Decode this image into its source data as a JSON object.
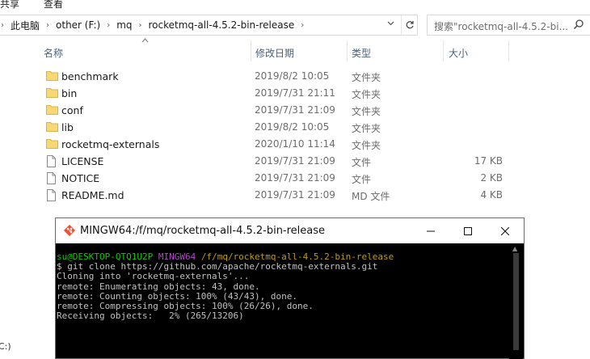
{
  "ribbon": {
    "tabs": [
      "共享",
      "查看"
    ]
  },
  "address_bar": {
    "crumbs": [
      "此电脑",
      "other (F:)",
      "mq",
      "rocketmq-all-4.5.2-bin-release"
    ]
  },
  "search": {
    "placeholder": "搜索\"rocketmq-all-4.5.2-bi..."
  },
  "columns": {
    "name": "名称",
    "date": "修改日期",
    "type": "类型",
    "size": "大小"
  },
  "files": [
    {
      "name": "benchmark",
      "date": "2019/8/2 10:05",
      "type": "文件夹",
      "size": "",
      "kind": "folder"
    },
    {
      "name": "bin",
      "date": "2019/7/31 21:11",
      "type": "文件夹",
      "size": "",
      "kind": "folder"
    },
    {
      "name": "conf",
      "date": "2019/7/31 21:09",
      "type": "文件夹",
      "size": "",
      "kind": "folder"
    },
    {
      "name": "lib",
      "date": "2019/8/2 10:05",
      "type": "文件夹",
      "size": "",
      "kind": "folder"
    },
    {
      "name": "rocketmq-externals",
      "date": "2020/1/10 11:14",
      "type": "文件夹",
      "size": "",
      "kind": "folder"
    },
    {
      "name": "LICENSE",
      "date": "2019/7/31 21:09",
      "type": "文件",
      "size": "17 KB",
      "kind": "file"
    },
    {
      "name": "NOTICE",
      "date": "2019/7/31 21:09",
      "type": "文件",
      "size": "2 KB",
      "kind": "file"
    },
    {
      "name": "README.md",
      "date": "2019/7/31 21:09",
      "type": "MD 文件",
      "size": "4 KB",
      "kind": "file"
    }
  ],
  "left_edge": {
    "text": "C:)"
  },
  "terminal": {
    "title": "MINGW64:/f/mq/rocketmq-all-4.5.2-bin-release",
    "prompt_user": "su@DESKTOP-QTQ1U2P",
    "prompt_env": "MINGW64",
    "prompt_path": "/f/mq/rocketmq-all-4.5.2-bin-release",
    "lines": [
      "$ git clone https://github.com/apache/rocketmq-externals.git",
      "Cloning into 'rocketmq-externals'...",
      "remote: Enumerating objects: 43, done.",
      "remote: Counting objects: 100% (43/43), done.",
      "remote: Compressing objects: 100% (26/26), done.",
      "Receiving objects:   2% (265/13206)"
    ]
  },
  "colors": {
    "folder": "#f8d775",
    "header_text": "#4c607a",
    "prompt_green": "#16c60c",
    "prompt_magenta": "#b148c6",
    "prompt_yellow": "#c19c00"
  }
}
